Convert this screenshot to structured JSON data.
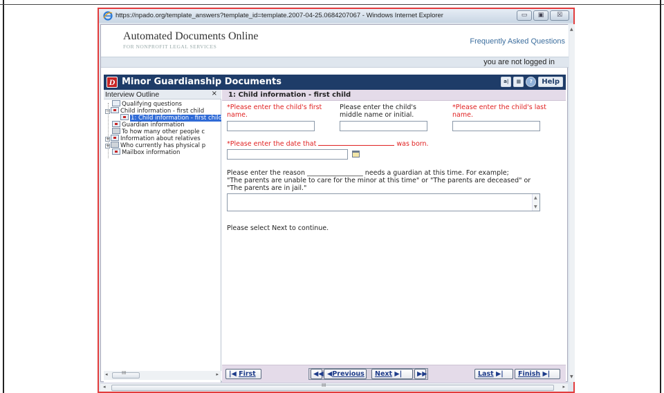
{
  "browser": {
    "title": "https://npado.org/template_answers?template_id=template.2007-04-25.0684207067 - Windows Internet Explorer",
    "minimize_glyph": "▭",
    "maximize_glyph": "▣",
    "close_glyph": "☒",
    "scroll_grip": "III"
  },
  "site": {
    "logo_main": "Automated Documents Online",
    "logo_sub": "FOR NONPROFIT LEGAL SERVICES",
    "faq_link": "Frequently Asked Questions",
    "login_status": "you are not logged in"
  },
  "app": {
    "title": "Minor Guardianship Documents",
    "logo_letter": "D",
    "tools": [
      "a|",
      "▦",
      "?"
    ],
    "help_label": "Help"
  },
  "outline": {
    "header": "Interview Outline",
    "close": "×",
    "items": [
      "Qualifying questions",
      "Child information - first child",
      "1: Child information - first child",
      "Guardian information",
      "To how many other people c",
      "Information about relatives",
      "Who currently has physical p",
      "Mailbox information"
    ],
    "expanders": [
      "−",
      "+",
      "+"
    ],
    "scroll_grip": "III"
  },
  "main": {
    "section_title": "1: Child information - first child",
    "q_first_name": [
      "*Please enter the child's first",
      "name."
    ],
    "q_middle_name": [
      "Please enter the child's",
      "middle name or initial."
    ],
    "q_last_name": [
      "*Please enter the child's last",
      "name."
    ],
    "q_date_pre": "*Please enter the date that",
    "q_date_post": "was born.",
    "q_reason": [
      "Please enter the reason _________________ needs a guardian at this time. For example;",
      "\"The parents are unable to care for the minor at this time\" or \"The parents are deceased\" or",
      "\"The parents are in jail.\""
    ],
    "continue_text": "Please select Next to continue."
  },
  "nav": {
    "first": "First",
    "previous": "Previous",
    "next": "Next",
    "last": "Last",
    "finish": "Finish"
  },
  "colors": {
    "required_text": "#e02020",
    "app_bar": "#1e3c68",
    "section_head": "#e4dbe9",
    "selected_item": "#2f6ad6",
    "window_border": "#e23b3b"
  }
}
